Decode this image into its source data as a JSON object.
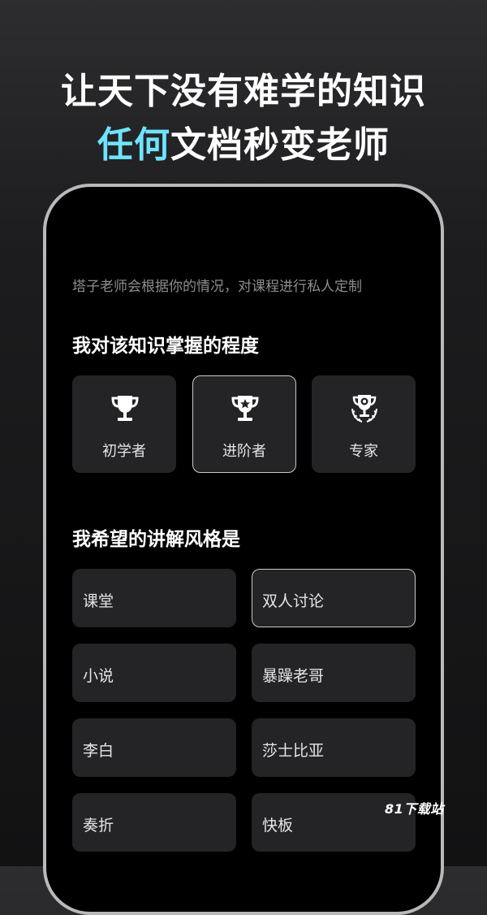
{
  "headline": {
    "line1": "让天下没有难学的知识",
    "line2_accent": "任何",
    "line2_rest": "文档秒变老师"
  },
  "screen": {
    "subtitle": "塔子老师会根据你的情况，对课程进行私人定制",
    "level_section_title": "我对该知识掌握的程度",
    "levels": [
      {
        "label": "初学者",
        "icon": "trophy-plain-icon",
        "selected": false
      },
      {
        "label": "进阶者",
        "icon": "trophy-star-icon",
        "selected": true
      },
      {
        "label": "专家",
        "icon": "trophy-laurel-icon",
        "selected": false
      }
    ],
    "style_section_title": "我希望的讲解风格是",
    "styles": [
      {
        "label": "课堂",
        "selected": false
      },
      {
        "label": "双人讨论",
        "selected": true
      },
      {
        "label": "小说",
        "selected": false
      },
      {
        "label": "暴躁老哥",
        "selected": false
      },
      {
        "label": "李白",
        "selected": false
      },
      {
        "label": "莎士比亚",
        "selected": false
      },
      {
        "label": "奏折",
        "selected": false
      },
      {
        "label": "快板",
        "selected": false
      }
    ]
  },
  "watermark": "81下载站",
  "colors": {
    "accent": "#6fe3ff",
    "card_bg": "#242426",
    "selected_border": "#c9c9cc",
    "screen_bg": "#000000"
  }
}
